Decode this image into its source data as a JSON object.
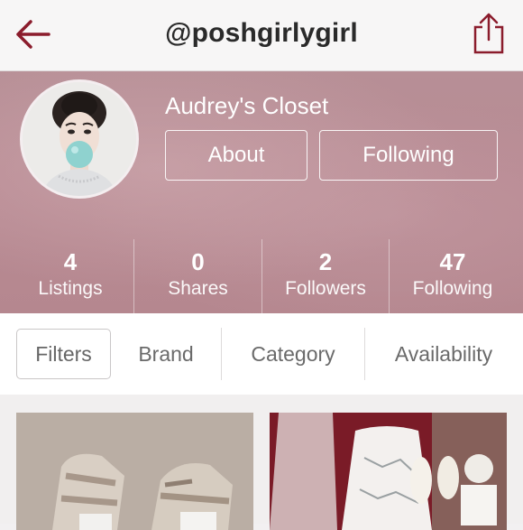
{
  "header": {
    "back_icon": "back-arrow-icon",
    "username": "@poshgirlygirl",
    "share_icon": "share-icon"
  },
  "profile": {
    "closet_name": "Audrey's Closet",
    "about_label": "About",
    "following_label": "Following",
    "stats": [
      {
        "count": "4",
        "label": "Listings"
      },
      {
        "count": "0",
        "label": "Shares"
      },
      {
        "count": "2",
        "label": "Followers"
      },
      {
        "count": "47",
        "label": "Following"
      }
    ]
  },
  "filters": {
    "filters_label": "Filters",
    "tabs": [
      "Brand",
      "Category",
      "Availability"
    ]
  },
  "colors": {
    "accent": "#8b1c2c",
    "banner": "#b88a93"
  }
}
